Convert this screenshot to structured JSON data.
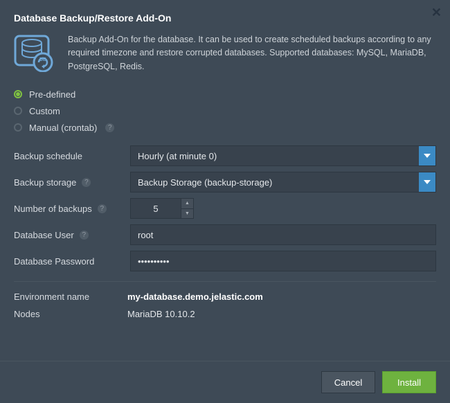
{
  "title": "Database Backup/Restore Add-On",
  "description": "Backup Add-On for the database. It can be used to create scheduled backups according to any required timezone and restore corrupted databases. Supported databases: MySQL, MariaDB, PostgreSQL, Redis.",
  "radios": {
    "predefined": "Pre-defined",
    "custom": "Custom",
    "manual": "Manual (crontab)"
  },
  "labels": {
    "backup_schedule": "Backup schedule",
    "backup_storage": "Backup storage",
    "number_of_backups": "Number of backups",
    "database_user": "Database User",
    "database_password": "Database Password",
    "environment_name": "Environment name",
    "nodes": "Nodes"
  },
  "values": {
    "backup_schedule": "Hourly (at minute 0)",
    "backup_storage": "Backup Storage (backup-storage)",
    "number_of_backups": "5",
    "database_user": "root",
    "database_password": "••••••••••",
    "environment_name": "my-database.demo.jelastic.com",
    "nodes": "MariaDB 10.10.2"
  },
  "footer": {
    "cancel": "Cancel",
    "install": "Install"
  }
}
